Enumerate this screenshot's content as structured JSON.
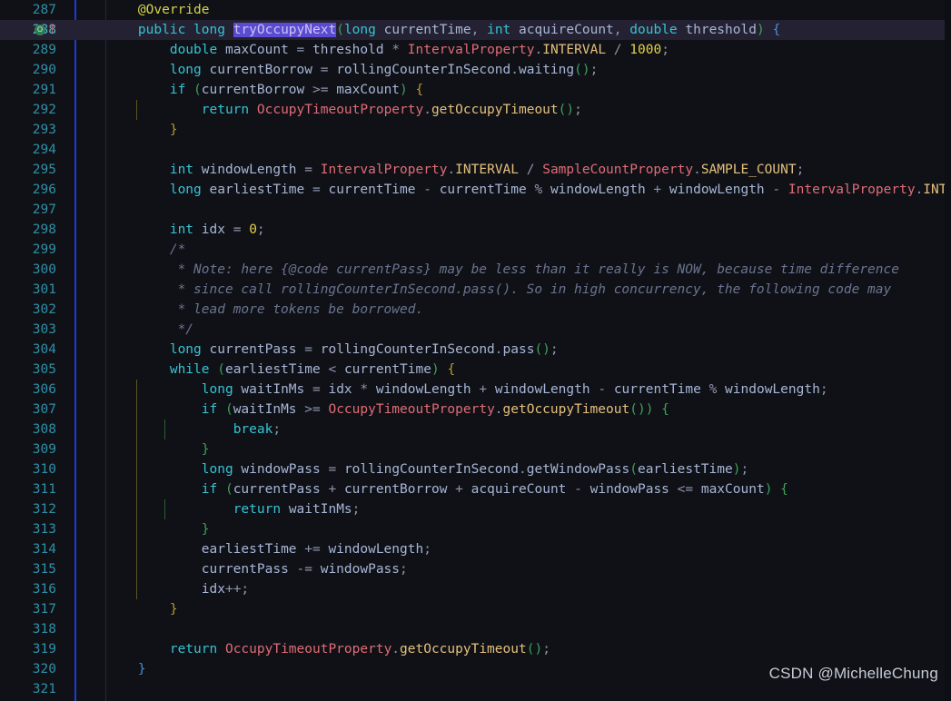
{
  "editor": {
    "theme_background": "#0f1117",
    "current_line_background": "#242232",
    "gutter_border_color": "#1d3bd6",
    "watermark": "CSDN @MichelleChung",
    "current_line_number": 288,
    "selection_text": "tryOccupyNext",
    "gutter_icons": {
      "override_marker": "O",
      "override_marker_name": "override-method-indicator",
      "implements_arrow": "↑",
      "implements_arrow_name": "overriding-method-arrow"
    }
  },
  "lines": [
    {
      "no": "287",
      "indent": 0,
      "guides": [],
      "tokens": [
        {
          "t": "    ",
          "c": "punc"
        },
        {
          "t": "@Override",
          "c": "anno"
        }
      ]
    },
    {
      "no": "288",
      "indent": 0,
      "current": true,
      "icons": true,
      "guides": [],
      "tokens": [
        {
          "t": "    ",
          "c": "punc"
        },
        {
          "t": "public",
          "c": "kw"
        },
        {
          "t": " ",
          "c": "punc"
        },
        {
          "t": "long",
          "c": "kw"
        },
        {
          "t": " ",
          "c": "punc"
        },
        {
          "t": "tryOccupyNext",
          "c": "sel"
        },
        {
          "t": "(",
          "c": "p1"
        },
        {
          "t": "long",
          "c": "kw"
        },
        {
          "t": " ",
          "c": "punc"
        },
        {
          "t": "currentTime",
          "c": "id"
        },
        {
          "t": ", ",
          "c": "punc"
        },
        {
          "t": "int",
          "c": "kw"
        },
        {
          "t": " ",
          "c": "punc"
        },
        {
          "t": "acquireCount",
          "c": "id"
        },
        {
          "t": ", ",
          "c": "punc"
        },
        {
          "t": "double",
          "c": "kw"
        },
        {
          "t": " ",
          "c": "punc"
        },
        {
          "t": "threshold",
          "c": "id"
        },
        {
          "t": ")",
          "c": "p1"
        },
        {
          "t": " ",
          "c": "punc"
        },
        {
          "t": "{",
          "c": "p3"
        }
      ]
    },
    {
      "no": "289",
      "guides": [],
      "tokens": [
        {
          "t": "        ",
          "c": "punc"
        },
        {
          "t": "double",
          "c": "kw"
        },
        {
          "t": " ",
          "c": "punc"
        },
        {
          "t": "maxCount",
          "c": "id"
        },
        {
          "t": " = ",
          "c": "punc"
        },
        {
          "t": "threshold",
          "c": "id"
        },
        {
          "t": " * ",
          "c": "punc"
        },
        {
          "t": "IntervalProperty",
          "c": "cls"
        },
        {
          "t": ".",
          "c": "punc"
        },
        {
          "t": "INTERVAL",
          "c": "stat"
        },
        {
          "t": " / ",
          "c": "punc"
        },
        {
          "t": "1000",
          "c": "num"
        },
        {
          "t": ";",
          "c": "punc"
        }
      ]
    },
    {
      "no": "290",
      "guides": [],
      "tokens": [
        {
          "t": "        ",
          "c": "punc"
        },
        {
          "t": "long",
          "c": "kw"
        },
        {
          "t": " ",
          "c": "punc"
        },
        {
          "t": "currentBorrow",
          "c": "id"
        },
        {
          "t": " = ",
          "c": "punc"
        },
        {
          "t": "rollingCounterInSecond",
          "c": "id"
        },
        {
          "t": ".",
          "c": "punc"
        },
        {
          "t": "waiting",
          "c": "id"
        },
        {
          "t": "()",
          "c": "p1"
        },
        {
          "t": ";",
          "c": "punc"
        }
      ]
    },
    {
      "no": "291",
      "guides": [],
      "tokens": [
        {
          "t": "        ",
          "c": "punc"
        },
        {
          "t": "if",
          "c": "kw"
        },
        {
          "t": " ",
          "c": "punc"
        },
        {
          "t": "(",
          "c": "p1"
        },
        {
          "t": "currentBorrow",
          "c": "id"
        },
        {
          "t": " >= ",
          "c": "punc"
        },
        {
          "t": "maxCount",
          "c": "id"
        },
        {
          "t": ")",
          "c": "p1"
        },
        {
          "t": " ",
          "c": "punc"
        },
        {
          "t": "{",
          "c": "p2"
        }
      ]
    },
    {
      "no": "292",
      "guides": [
        150
      ],
      "tokens": [
        {
          "t": "            ",
          "c": "punc"
        },
        {
          "t": "return",
          "c": "kw"
        },
        {
          "t": " ",
          "c": "punc"
        },
        {
          "t": "OccupyTimeoutProperty",
          "c": "cls"
        },
        {
          "t": ".",
          "c": "punc"
        },
        {
          "t": "getOccupyTimeout",
          "c": "stat"
        },
        {
          "t": "()",
          "c": "p1"
        },
        {
          "t": ";",
          "c": "punc"
        }
      ]
    },
    {
      "no": "293",
      "guides": [],
      "tokens": [
        {
          "t": "        ",
          "c": "punc"
        },
        {
          "t": "}",
          "c": "p2"
        }
      ]
    },
    {
      "no": "294",
      "guides": [],
      "tokens": []
    },
    {
      "no": "295",
      "guides": [],
      "tokens": [
        {
          "t": "        ",
          "c": "punc"
        },
        {
          "t": "int",
          "c": "kw"
        },
        {
          "t": " ",
          "c": "punc"
        },
        {
          "t": "windowLength",
          "c": "id"
        },
        {
          "t": " = ",
          "c": "punc"
        },
        {
          "t": "IntervalProperty",
          "c": "cls"
        },
        {
          "t": ".",
          "c": "punc"
        },
        {
          "t": "INTERVAL",
          "c": "stat"
        },
        {
          "t": " / ",
          "c": "punc"
        },
        {
          "t": "SampleCountProperty",
          "c": "cls"
        },
        {
          "t": ".",
          "c": "punc"
        },
        {
          "t": "SAMPLE_COUNT",
          "c": "stat"
        },
        {
          "t": ";",
          "c": "punc"
        }
      ]
    },
    {
      "no": "296",
      "guides": [],
      "tokens": [
        {
          "t": "        ",
          "c": "punc"
        },
        {
          "t": "long",
          "c": "kw"
        },
        {
          "t": " ",
          "c": "punc"
        },
        {
          "t": "earliestTime",
          "c": "id"
        },
        {
          "t": " = ",
          "c": "punc"
        },
        {
          "t": "currentTime",
          "c": "id"
        },
        {
          "t": " - ",
          "c": "punc"
        },
        {
          "t": "currentTime",
          "c": "id"
        },
        {
          "t": " % ",
          "c": "punc"
        },
        {
          "t": "windowLength",
          "c": "id"
        },
        {
          "t": " + ",
          "c": "punc"
        },
        {
          "t": "windowLength",
          "c": "id"
        },
        {
          "t": " - ",
          "c": "punc"
        },
        {
          "t": "IntervalProperty",
          "c": "cls"
        },
        {
          "t": ".",
          "c": "punc"
        },
        {
          "t": "INTERVAL",
          "c": "stat"
        },
        {
          "t": ";",
          "c": "punc"
        }
      ]
    },
    {
      "no": "297",
      "guides": [],
      "tokens": []
    },
    {
      "no": "298",
      "guides": [],
      "tokens": [
        {
          "t": "        ",
          "c": "punc"
        },
        {
          "t": "int",
          "c": "kw"
        },
        {
          "t": " ",
          "c": "punc"
        },
        {
          "t": "idx",
          "c": "id"
        },
        {
          "t": " = ",
          "c": "punc"
        },
        {
          "t": "0",
          "c": "num"
        },
        {
          "t": ";",
          "c": "punc"
        }
      ]
    },
    {
      "no": "299",
      "guides": [],
      "tokens": [
        {
          "t": "        /*",
          "c": "cmt"
        }
      ]
    },
    {
      "no": "300",
      "guides": [],
      "tokens": [
        {
          "t": "         * Note: here {@code currentPass} may be less than it really is NOW, because time difference",
          "c": "cmt"
        }
      ]
    },
    {
      "no": "301",
      "guides": [],
      "tokens": [
        {
          "t": "         * since call rollingCounterInSecond.pass(). So in high concurrency, the following code may",
          "c": "cmt"
        }
      ]
    },
    {
      "no": "302",
      "guides": [],
      "tokens": [
        {
          "t": "         * lead more tokens be borrowed.",
          "c": "cmt"
        }
      ]
    },
    {
      "no": "303",
      "guides": [],
      "tokens": [
        {
          "t": "         */",
          "c": "cmt"
        }
      ]
    },
    {
      "no": "304",
      "guides": [],
      "tokens": [
        {
          "t": "        ",
          "c": "punc"
        },
        {
          "t": "long",
          "c": "kw"
        },
        {
          "t": " ",
          "c": "punc"
        },
        {
          "t": "currentPass",
          "c": "id"
        },
        {
          "t": " = ",
          "c": "punc"
        },
        {
          "t": "rollingCounterInSecond",
          "c": "id"
        },
        {
          "t": ".",
          "c": "punc"
        },
        {
          "t": "pass",
          "c": "id"
        },
        {
          "t": "()",
          "c": "p1"
        },
        {
          "t": ";",
          "c": "punc"
        }
      ]
    },
    {
      "no": "305",
      "guides": [],
      "tokens": [
        {
          "t": "        ",
          "c": "punc"
        },
        {
          "t": "while",
          "c": "kw"
        },
        {
          "t": " ",
          "c": "punc"
        },
        {
          "t": "(",
          "c": "p1"
        },
        {
          "t": "earliestTime",
          "c": "id"
        },
        {
          "t": " < ",
          "c": "punc"
        },
        {
          "t": "currentTime",
          "c": "id"
        },
        {
          "t": ")",
          "c": "p1"
        },
        {
          "t": " ",
          "c": "punc"
        },
        {
          "t": "{",
          "c": "p2"
        }
      ]
    },
    {
      "no": "306",
      "guides": [
        150
      ],
      "tokens": [
        {
          "t": "            ",
          "c": "punc"
        },
        {
          "t": "long",
          "c": "kw"
        },
        {
          "t": " ",
          "c": "punc"
        },
        {
          "t": "waitInMs",
          "c": "id"
        },
        {
          "t": " = ",
          "c": "punc"
        },
        {
          "t": "idx",
          "c": "id"
        },
        {
          "t": " * ",
          "c": "punc"
        },
        {
          "t": "windowLength",
          "c": "id"
        },
        {
          "t": " + ",
          "c": "punc"
        },
        {
          "t": "windowLength",
          "c": "id"
        },
        {
          "t": " - ",
          "c": "punc"
        },
        {
          "t": "currentTime",
          "c": "id"
        },
        {
          "t": " % ",
          "c": "punc"
        },
        {
          "t": "windowLength",
          "c": "id"
        },
        {
          "t": ";",
          "c": "punc"
        }
      ]
    },
    {
      "no": "307",
      "guides": [
        150
      ],
      "tokens": [
        {
          "t": "            ",
          "c": "punc"
        },
        {
          "t": "if",
          "c": "kw"
        },
        {
          "t": " ",
          "c": "punc"
        },
        {
          "t": "(",
          "c": "p1"
        },
        {
          "t": "waitInMs",
          "c": "id"
        },
        {
          "t": " >= ",
          "c": "punc"
        },
        {
          "t": "OccupyTimeoutProperty",
          "c": "cls"
        },
        {
          "t": ".",
          "c": "punc"
        },
        {
          "t": "getOccupyTimeout",
          "c": "stat"
        },
        {
          "t": "()",
          "c": "p1"
        },
        {
          "t": ")",
          "c": "p1"
        },
        {
          "t": " ",
          "c": "punc"
        },
        {
          "t": "{",
          "c": "p1"
        }
      ]
    },
    {
      "no": "308",
      "guides": [
        150,
        181
      ],
      "tokens": [
        {
          "t": "                ",
          "c": "punc"
        },
        {
          "t": "break",
          "c": "kw"
        },
        {
          "t": ";",
          "c": "punc"
        }
      ]
    },
    {
      "no": "309",
      "guides": [
        150
      ],
      "tokens": [
        {
          "t": "            ",
          "c": "punc"
        },
        {
          "t": "}",
          "c": "p1"
        }
      ]
    },
    {
      "no": "310",
      "guides": [
        150
      ],
      "tokens": [
        {
          "t": "            ",
          "c": "punc"
        },
        {
          "t": "long",
          "c": "kw"
        },
        {
          "t": " ",
          "c": "punc"
        },
        {
          "t": "windowPass",
          "c": "id"
        },
        {
          "t": " = ",
          "c": "punc"
        },
        {
          "t": "rollingCounterInSecond",
          "c": "id"
        },
        {
          "t": ".",
          "c": "punc"
        },
        {
          "t": "getWindowPass",
          "c": "id"
        },
        {
          "t": "(",
          "c": "p1"
        },
        {
          "t": "earliestTime",
          "c": "id"
        },
        {
          "t": ")",
          "c": "p1"
        },
        {
          "t": ";",
          "c": "punc"
        }
      ]
    },
    {
      "no": "311",
      "guides": [
        150
      ],
      "tokens": [
        {
          "t": "            ",
          "c": "punc"
        },
        {
          "t": "if",
          "c": "kw"
        },
        {
          "t": " ",
          "c": "punc"
        },
        {
          "t": "(",
          "c": "p1"
        },
        {
          "t": "currentPass",
          "c": "id"
        },
        {
          "t": " + ",
          "c": "punc"
        },
        {
          "t": "currentBorrow",
          "c": "id"
        },
        {
          "t": " + ",
          "c": "punc"
        },
        {
          "t": "acquireCount",
          "c": "id"
        },
        {
          "t": " - ",
          "c": "punc"
        },
        {
          "t": "windowPass",
          "c": "id"
        },
        {
          "t": " <= ",
          "c": "punc"
        },
        {
          "t": "maxCount",
          "c": "id"
        },
        {
          "t": ")",
          "c": "p1"
        },
        {
          "t": " ",
          "c": "punc"
        },
        {
          "t": "{",
          "c": "p1"
        }
      ]
    },
    {
      "no": "312",
      "guides": [
        150,
        181
      ],
      "tokens": [
        {
          "t": "                ",
          "c": "punc"
        },
        {
          "t": "return",
          "c": "kw"
        },
        {
          "t": " ",
          "c": "punc"
        },
        {
          "t": "waitInMs",
          "c": "id"
        },
        {
          "t": ";",
          "c": "punc"
        }
      ]
    },
    {
      "no": "313",
      "guides": [
        150
      ],
      "tokens": [
        {
          "t": "            ",
          "c": "punc"
        },
        {
          "t": "}",
          "c": "p1"
        }
      ]
    },
    {
      "no": "314",
      "guides": [
        150
      ],
      "tokens": [
        {
          "t": "            ",
          "c": "punc"
        },
        {
          "t": "earliestTime",
          "c": "id"
        },
        {
          "t": " += ",
          "c": "punc"
        },
        {
          "t": "windowLength",
          "c": "id"
        },
        {
          "t": ";",
          "c": "punc"
        }
      ]
    },
    {
      "no": "315",
      "guides": [
        150
      ],
      "tokens": [
        {
          "t": "            ",
          "c": "punc"
        },
        {
          "t": "currentPass",
          "c": "id"
        },
        {
          "t": " -= ",
          "c": "punc"
        },
        {
          "t": "windowPass",
          "c": "id"
        },
        {
          "t": ";",
          "c": "punc"
        }
      ]
    },
    {
      "no": "316",
      "guides": [
        150
      ],
      "tokens": [
        {
          "t": "            ",
          "c": "punc"
        },
        {
          "t": "idx",
          "c": "id"
        },
        {
          "t": "++;",
          "c": "punc"
        }
      ]
    },
    {
      "no": "317",
      "guides": [],
      "tokens": [
        {
          "t": "        ",
          "c": "punc"
        },
        {
          "t": "}",
          "c": "p2"
        }
      ]
    },
    {
      "no": "318",
      "guides": [],
      "tokens": []
    },
    {
      "no": "319",
      "guides": [],
      "tokens": [
        {
          "t": "        ",
          "c": "punc"
        },
        {
          "t": "return",
          "c": "kw"
        },
        {
          "t": " ",
          "c": "punc"
        },
        {
          "t": "OccupyTimeoutProperty",
          "c": "cls"
        },
        {
          "t": ".",
          "c": "punc"
        },
        {
          "t": "getOccupyTimeout",
          "c": "stat"
        },
        {
          "t": "()",
          "c": "p1"
        },
        {
          "t": ";",
          "c": "punc"
        }
      ]
    },
    {
      "no": "320",
      "guides": [],
      "tokens": [
        {
          "t": "    ",
          "c": "punc"
        },
        {
          "t": "}",
          "c": "p3"
        }
      ]
    },
    {
      "no": "321",
      "guides": [],
      "tokens": []
    }
  ]
}
